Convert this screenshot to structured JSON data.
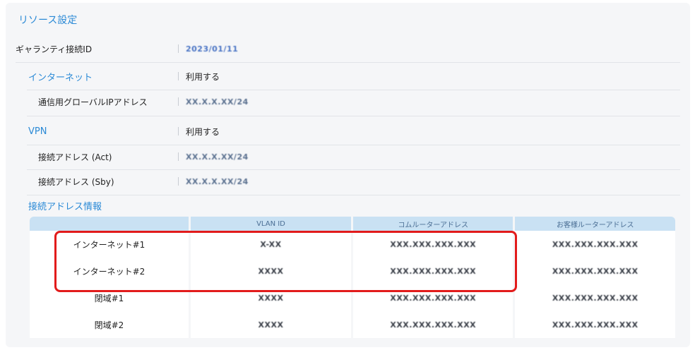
{
  "section_title": "リソース設定",
  "guarantee_id": {
    "label": "ギャランティ接続ID",
    "value": "2023/01/11"
  },
  "internet": {
    "heading": "インターネット",
    "status": "利用する",
    "global_ip": {
      "label": "通信用グローバルIPアドレス",
      "value": "XX.X.X.XX/24"
    }
  },
  "vpn": {
    "heading": "VPN",
    "status": "利用する",
    "act": {
      "label": "接続アドレス (Act)",
      "value": "XX.X.X.XX/24"
    },
    "sby": {
      "label": "接続アドレス (Sby)",
      "value": "XX.X.X.XX/24"
    }
  },
  "connection_info": {
    "heading": "接続アドレス情報",
    "columns": [
      "",
      "VLAN ID",
      "コムルーターアドレス",
      "お客様ルーターアドレス"
    ],
    "rows": [
      {
        "name": "インターネット#1",
        "vlan": "X-XX",
        "com_router": "XXX.XXX.XXX.XXX",
        "customer_router": "XXX.XXX.XXX.XXX"
      },
      {
        "name": "インターネット#2",
        "vlan": "XXXX",
        "com_router": "XXX.XXX.XXX.XXX",
        "customer_router": "XXX.XXX.XXX.XXX"
      },
      {
        "name": "閉域#1",
        "vlan": "XXXX",
        "com_router": "XXX.XXX.XXX.XXX",
        "customer_router": "XXX.XXX.XXX.XXX"
      },
      {
        "name": "閉域#2",
        "vlan": "XXXX",
        "com_router": "XXX.XXX.XXX.XXX",
        "customer_router": "XXX.XXX.XXX.XXX"
      }
    ]
  },
  "colors": {
    "accent": "#2b8ad6",
    "highlight": "#e21b1b",
    "table_header": "#c9e1f3"
  }
}
